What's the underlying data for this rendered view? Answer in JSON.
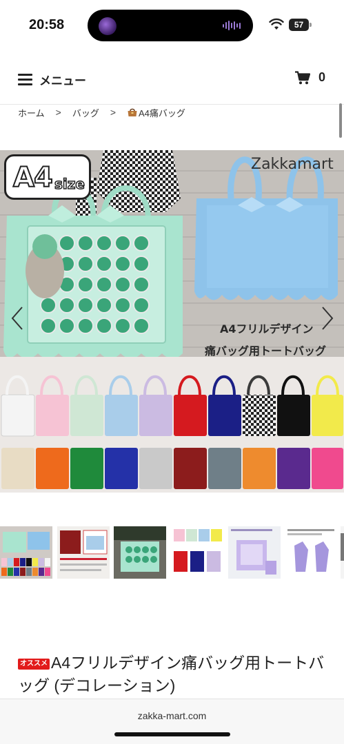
{
  "status_bar": {
    "time": "20:58",
    "battery_level": "57",
    "icons": [
      "wifi-icon",
      "battery-icon",
      "audio-wave-icon"
    ]
  },
  "header": {
    "menu_label": "メニュー",
    "cart_count": "0",
    "icons": [
      "hamburger-icon",
      "cart-icon"
    ]
  },
  "breadcrumb": {
    "items": [
      "ホーム",
      "バッグ",
      "A4痛バッグ"
    ],
    "separator": ">"
  },
  "hero": {
    "badge_main": "A4",
    "badge_size": "size",
    "brand": "Zakkamart",
    "caption_line1": "A4フリルデザイン",
    "caption_line2": "痛バッグ用トートバッグ",
    "color_swatches_row1": [
      "#f4f4f4",
      "#f6c3d4",
      "#cfe7d4",
      "#a9cdea",
      "#cbbbe2",
      "#d51a1f",
      "#1b1f86",
      "#3b3b3b",
      "#111111",
      "#f2ea4b"
    ],
    "color_swatches_row2": [
      "#e8dcc4",
      "#ee6a1c",
      "#1f8a3b",
      "#2431a8",
      "#c9c9c9",
      "#8c1c1c",
      "#6f7f88",
      "#ee8b2e",
      "#5a2a8e",
      "#f04a8e"
    ]
  },
  "thumbnails": [
    "thumb-1",
    "thumb-2",
    "thumb-3",
    "thumb-4",
    "thumb-5",
    "thumb-6",
    "thumb-7"
  ],
  "product": {
    "badge": "オススメ",
    "title": "A4フリルデザイン痛バッグ用トートバッグ (デコレーション)"
  },
  "browser": {
    "url": "zakka-mart.com"
  },
  "colors": {
    "mint": "#a9e4cf",
    "sky": "#8ec3ea",
    "recommend_red": "#e21b1b"
  }
}
